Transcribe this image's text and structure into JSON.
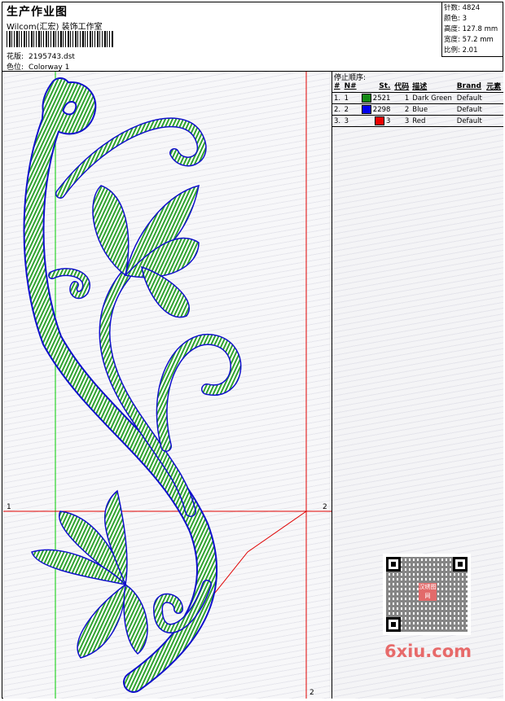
{
  "header": {
    "title": "生产作业图",
    "company": "Wilcom(汇宏) 装饰工作室",
    "design_label": "花版:",
    "design_value": "2195743.dst",
    "colorway_label": "色位:",
    "colorway_value": "Colorway 1"
  },
  "stats": {
    "stitches": "针数: 4824",
    "colors": "颜色: 3",
    "height": "高度: 127.8 mm",
    "width": "宽度: 57.2 mm",
    "ratio": "比例: 2.01"
  },
  "stop_sequence": {
    "label": "停止顺序:",
    "headers": [
      "#",
      "N#",
      "St.",
      "代码",
      "描述",
      "Brand",
      "元素"
    ],
    "rows": [
      {
        "idx": "1.",
        "n": "1",
        "st": "2521",
        "code": "1",
        "desc": "Dark Green",
        "brand": "Default",
        "color": "#138a13"
      },
      {
        "idx": "2.",
        "n": "2",
        "st": "2298",
        "code": "2",
        "desc": "Blue",
        "brand": "Default",
        "color": "#0000ee"
      },
      {
        "idx": "3.",
        "n": "3",
        "st": "3",
        "code": "3",
        "desc": "Red",
        "brand": "Default",
        "color": "#ee0000"
      }
    ]
  },
  "markers": {
    "left_h": "1",
    "right_h": "2",
    "bottom_v": "2"
  },
  "qr": {
    "center_text": "汉绣图网"
  },
  "watermark": "6xiu.com",
  "colors": {
    "stitch_green": "#2fa32f",
    "outline_blue": "#1010cc",
    "guide_red": "#e00000",
    "guide_green": "#00cc00"
  }
}
